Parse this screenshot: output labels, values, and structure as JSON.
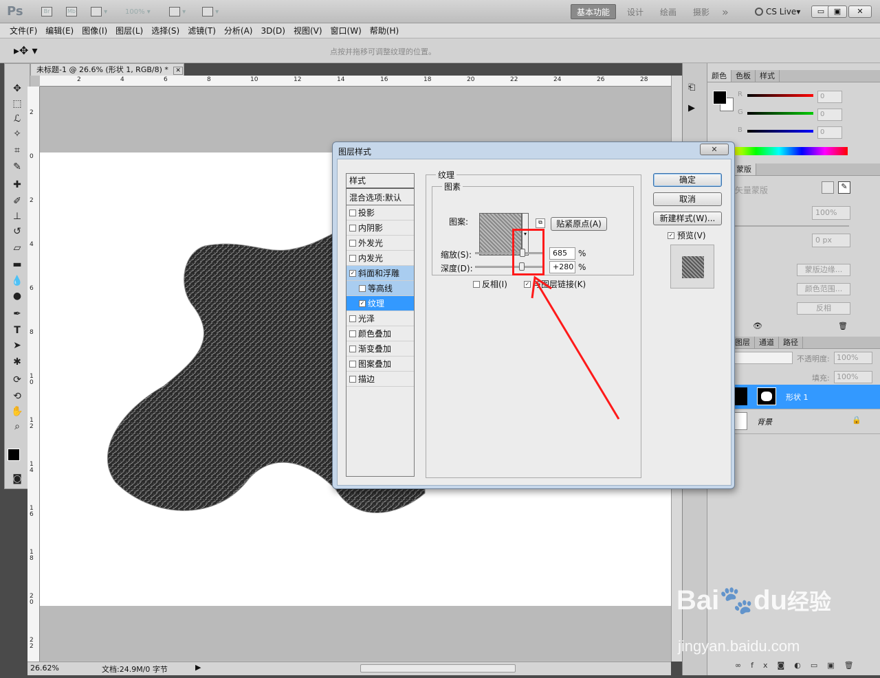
{
  "app": {
    "logo": "Ps",
    "bridge": "Br",
    "minibridge": "Mb",
    "zoom": "100%",
    "workspaces": [
      "基本功能",
      "设计",
      "绘画",
      "摄影"
    ],
    "more": "»",
    "cslive": "CS Live",
    "win_min": "▭",
    "win_restore": "▣",
    "win_close": "✕"
  },
  "menubar": [
    "文件(F)",
    "编辑(E)",
    "图像(I)",
    "图层(L)",
    "选择(S)",
    "滤镜(T)",
    "分析(A)",
    "3D(D)",
    "视图(V)",
    "窗口(W)",
    "帮助(H)"
  ],
  "options": {
    "hint": "点按并拖移可调整纹理的位置。"
  },
  "document": {
    "tab_title": "未标题-1 @ 26.6% (形状 1, RGB/8) *",
    "tab_close": "✕",
    "ruler_top": [
      "2",
      "4",
      "6",
      "8",
      "10",
      "12",
      "14",
      "16",
      "18",
      "20",
      "22",
      "24",
      "26",
      "28"
    ],
    "ruler_left": [
      "2",
      "0",
      "2",
      "4",
      "6",
      "8",
      "1\n0",
      "1\n2",
      "1\n4",
      "1\n6",
      "1\n8",
      "2\n0",
      "2\n2"
    ],
    "zoom_status": "26.62%",
    "doc_info": "文档:24.9M/0 字节"
  },
  "panels": {
    "color_tabs": [
      "颜色",
      "色板",
      "样式"
    ],
    "rgb": [
      {
        "label": "R",
        "value": "0"
      },
      {
        "label": "G",
        "value": "0"
      },
      {
        "label": "B",
        "value": "0"
      }
    ],
    "mask_tab": "蒙版",
    "mask_title": "矢量蒙版",
    "density": "100%",
    "feather": "0 px",
    "mask_buttons": [
      "蒙版边缘...",
      "颜色范围...",
      "反相"
    ],
    "layers_tabs": [
      "图层",
      "通道",
      "路径"
    ],
    "opacity_label": "不透明度:",
    "opacity": "100%",
    "fill_label": "填充:",
    "fill": "100%",
    "layers": [
      {
        "name": "形状 1",
        "selected": true
      },
      {
        "name": "背景",
        "selected": false
      }
    ]
  },
  "dialog": {
    "title": "图层样式",
    "close": "✕",
    "style_header": "样式",
    "blend": "混合选项:默认",
    "styles": [
      {
        "label": "投影",
        "checked": false
      },
      {
        "label": "内阴影",
        "checked": false
      },
      {
        "label": "外发光",
        "checked": false
      },
      {
        "label": "内发光",
        "checked": false
      },
      {
        "label": "斜面和浮雕",
        "checked": true
      },
      {
        "label": "等高线",
        "checked": false
      },
      {
        "label": "纹理",
        "checked": true
      },
      {
        "label": "光泽",
        "checked": false
      },
      {
        "label": "颜色叠加",
        "checked": false
      },
      {
        "label": "渐变叠加",
        "checked": false
      },
      {
        "label": "图案叠加",
        "checked": false
      },
      {
        "label": "描边",
        "checked": false
      }
    ],
    "section_title": "纹理",
    "sub_title": "图素",
    "pattern_label": "图案:",
    "snap_button": "贴紧原点(A)",
    "scale_label": "缩放(S):",
    "scale_value": "685",
    "scale_unit": "%",
    "scale_level": 0.69,
    "depth_label": "深度(D):",
    "depth_value": "+280",
    "depth_unit": "%",
    "depth_level": 0.68,
    "invert_label": "反相(I)",
    "link_label": "与图层链接(K)",
    "ok": "确定",
    "cancel": "取消",
    "new_style": "新建样式(W)...",
    "preview_label": "预览(V)"
  },
  "watermark": {
    "brand": "Bai",
    "brand2": "du",
    "cn": "经验",
    "url": "jingyan.baidu.com"
  },
  "colors": {
    "accent_selection": "#3399ff",
    "annotation_red": "#ff1a1a",
    "shape_fill": "#2a2a2a"
  }
}
